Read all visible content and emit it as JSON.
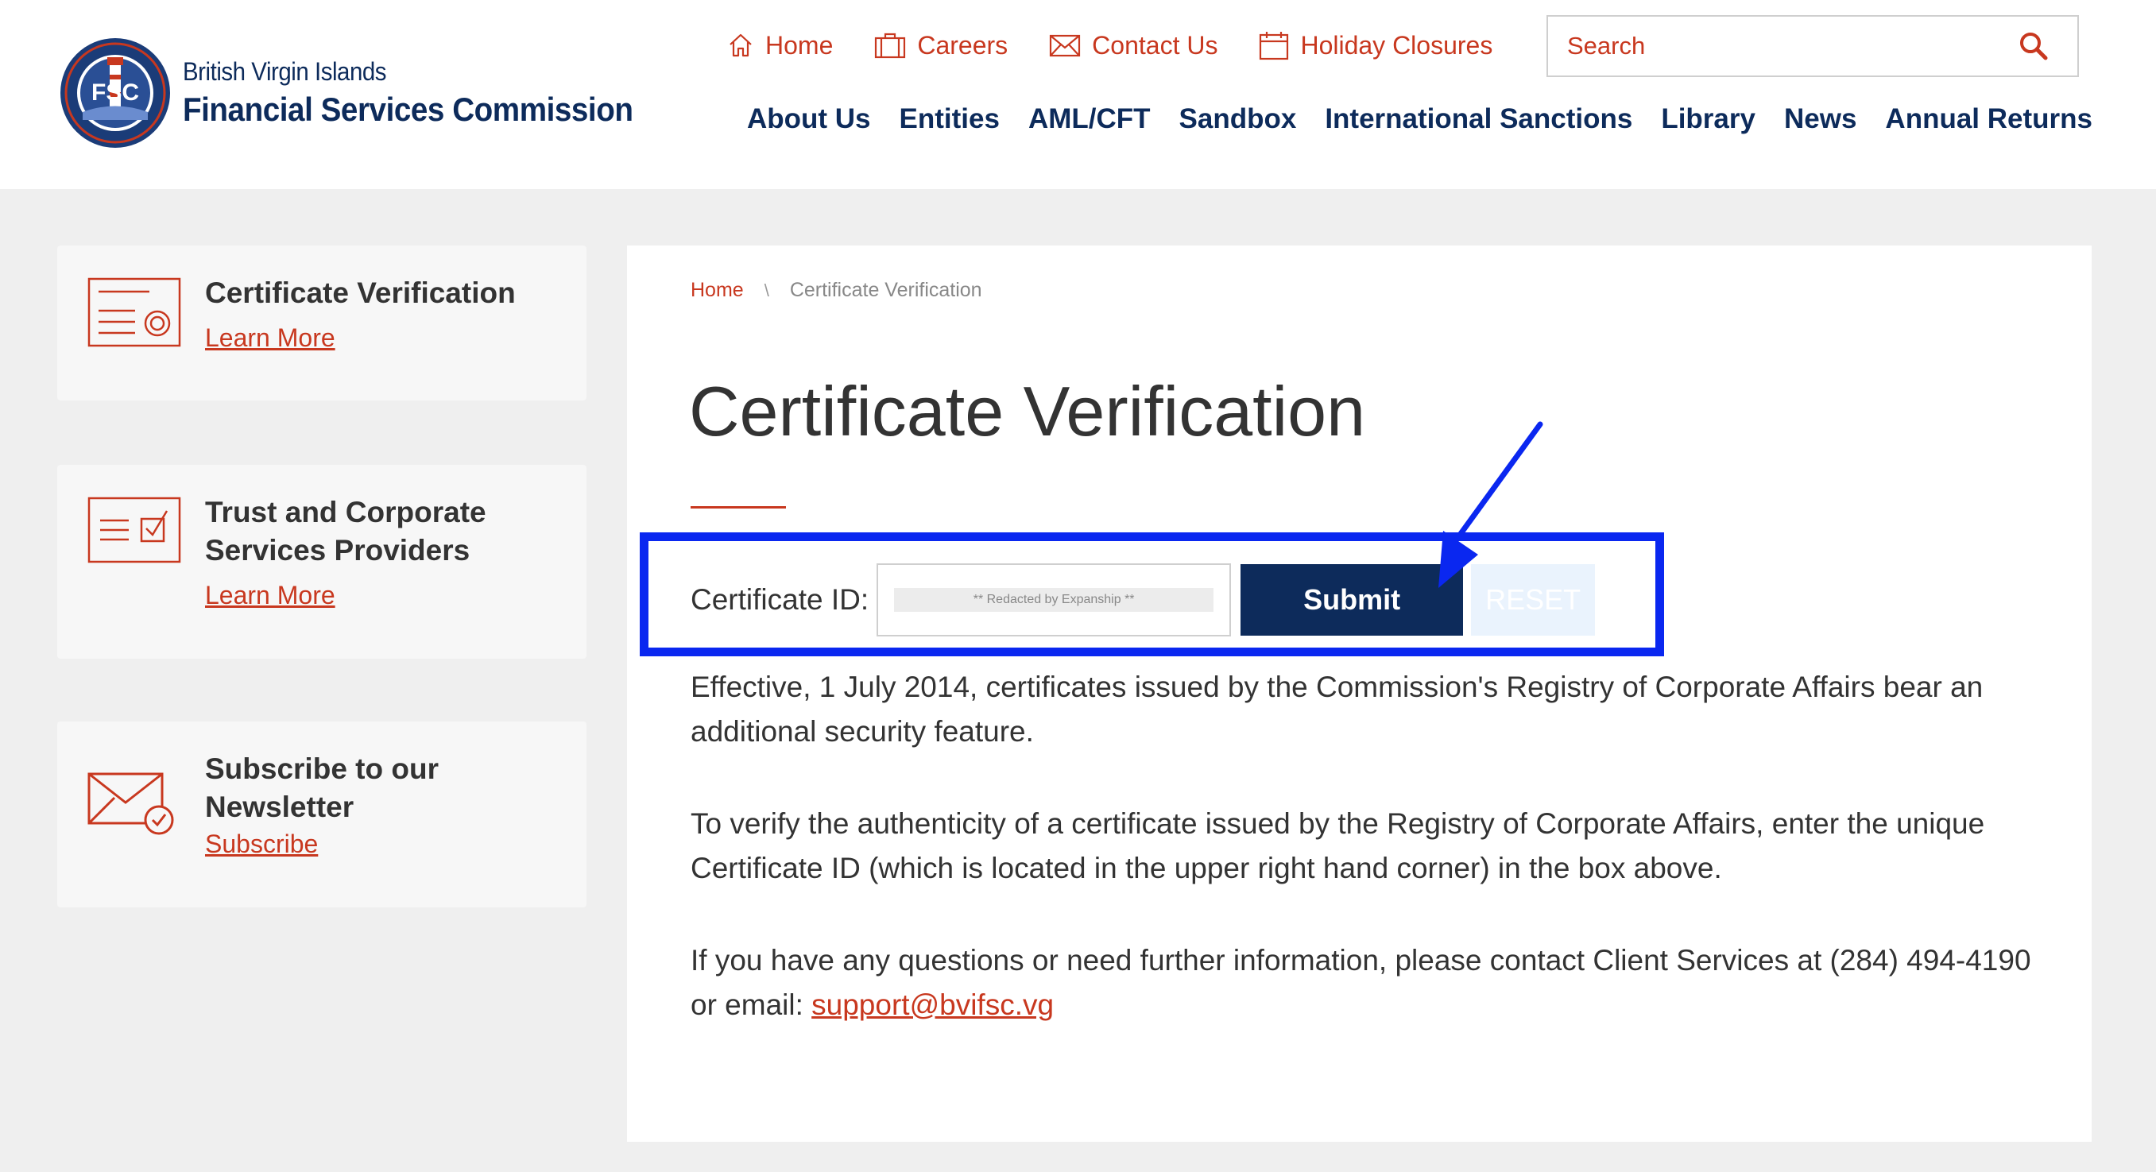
{
  "header": {
    "logo": {
      "line1": "British Virgin Islands",
      "line2": "Financial Services Commission",
      "seal_text": "FSC"
    },
    "utility_nav": [
      {
        "label": "Home",
        "icon": "home-icon"
      },
      {
        "label": "Careers",
        "icon": "briefcase-icon"
      },
      {
        "label": "Contact Us",
        "icon": "envelope-icon"
      },
      {
        "label": "Holiday Closures",
        "icon": "calendar-icon"
      }
    ],
    "search": {
      "placeholder": "Search",
      "icon": "search-icon"
    },
    "main_nav": [
      "About Us",
      "Entities",
      "AML/CFT",
      "Sandbox",
      "International Sanctions",
      "Library",
      "News",
      "Annual Returns"
    ]
  },
  "sidebar": {
    "cards": [
      {
        "title": "Certificate Verification",
        "link": "Learn More",
        "icon": "certificate-icon"
      },
      {
        "title": "Trust and Corporate Services Providers",
        "link": "Learn More",
        "icon": "checklist-icon"
      },
      {
        "title": "Subscribe to our Newsletter",
        "link": "Subscribe",
        "icon": "envelope-check-icon"
      }
    ]
  },
  "main": {
    "breadcrumb": {
      "home": "Home",
      "separator": "\\",
      "current": "Certificate Verification"
    },
    "title": "Certificate Verification",
    "form": {
      "label": "Certificate ID:",
      "input_value": "** Redacted by Expanship **",
      "submit_label": "Submit",
      "reset_label": "RESET"
    },
    "paragraphs": {
      "p1": "Effective, 1 July 2014, certificates issued by the Commission's Registry of Corporate Affairs bear an additional security feature.",
      "p2": "To verify the authenticity of a certificate issued by the Registry of Corporate Affairs, enter the unique Certificate ID (which is located in the upper right hand corner) in the box above.",
      "p3_text": "If you have any questions or need further information, please contact Client Services at (284) 494-4190 or email: ",
      "p3_email": "support@bvifsc.vg"
    }
  },
  "colors": {
    "brand_navy": "#0d2b5b",
    "accent_red": "#c8381f",
    "highlight_blue": "#0a27f0",
    "page_bg": "#efefef"
  }
}
